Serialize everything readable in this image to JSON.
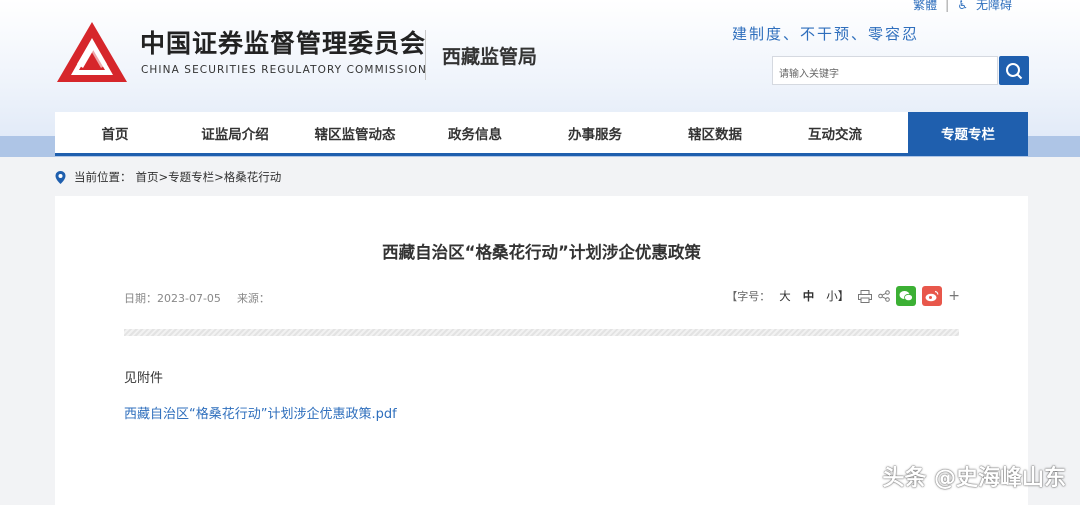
{
  "top_links": {
    "traditional": "繁體",
    "accessibility": "无障碍"
  },
  "header": {
    "org_name_cn": "中国证券监督管理委员会",
    "org_name_en": "CHINA SECURITIES REGULATORY COMMISSION",
    "bureau": "西藏监管局",
    "slogan": "建制度、不干预、零容忍",
    "brand_color": "#d6262b"
  },
  "search": {
    "placeholder": "请输入关键字"
  },
  "nav": {
    "items": [
      {
        "label": "首页"
      },
      {
        "label": "证监局介绍"
      },
      {
        "label": "辖区监管动态"
      },
      {
        "label": "政务信息"
      },
      {
        "label": "办事服务"
      },
      {
        "label": "辖区数据"
      },
      {
        "label": "互动交流"
      },
      {
        "label": "专题专栏",
        "active": true
      }
    ],
    "accent": "#1f5fae"
  },
  "breadcrumb": {
    "prefix": "当前位置：",
    "path": "首页>专题专栏>格桑花行动"
  },
  "article": {
    "title": "西藏自治区“格桑花行动”计划涉企优惠政策",
    "date_label": "日期：",
    "date": "2023-07-05",
    "source_label": "来源：",
    "source": "",
    "font_size_label": "【字号：",
    "size_large": "大",
    "size_medium": "中",
    "size_small": "小】",
    "body": "见附件",
    "attachment": "西藏自治区“格桑花行动”计划涉企优惠政策.pdf"
  },
  "watermark": "头条 @史海峰山东"
}
